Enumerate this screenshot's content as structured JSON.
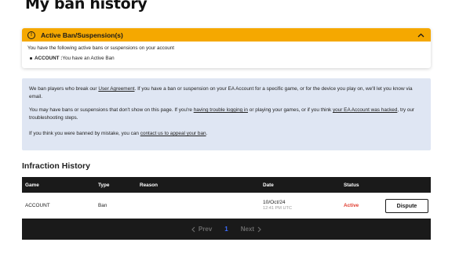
{
  "page": {
    "title": "My ban history"
  },
  "active_ban": {
    "title": "Active Ban/Suspension(s)",
    "intro": "You have the following active bans or suspensions on your account",
    "item_label": "ACCOUNT :",
    "item_text": "You have an Active Ban"
  },
  "info": {
    "p1_a": "We ban players who break our ",
    "p1_link": "User Agreement",
    "p1_b": ". If you have a ban or suspension on your EA Account for a specific game, or for the device you play on, we'll let you know via email.",
    "p2_a": "You may have bans or suspensions that don't show on this page. If you're ",
    "p2_link1": "having trouble logging in",
    "p2_b": " or playing your games, or if you think ",
    "p2_link2": "your EA Account was hacked",
    "p2_c": ", try our troubleshooting steps.",
    "p3_a": "If you think you were banned by mistake, you can ",
    "p3_link": "contact us to appeal your ban",
    "p3_b": "."
  },
  "history": {
    "title": "Infraction History",
    "columns": [
      "Game",
      "Type",
      "Reason",
      "Date",
      "Status"
    ],
    "rows": [
      {
        "game": "ACCOUNT",
        "type": "Ban",
        "reason": "",
        "date": "10/Oct/24",
        "time": "12:41 PM UTC",
        "status": "Active",
        "action": "Dispute"
      }
    ]
  },
  "pagination": {
    "prev": "Prev",
    "page": "1",
    "next": "Next"
  },
  "colors": {
    "warning": "#f5a800",
    "info_bg": "#dfe6f3",
    "active_status": "#e03b2d",
    "current_page": "#3b6cff"
  }
}
